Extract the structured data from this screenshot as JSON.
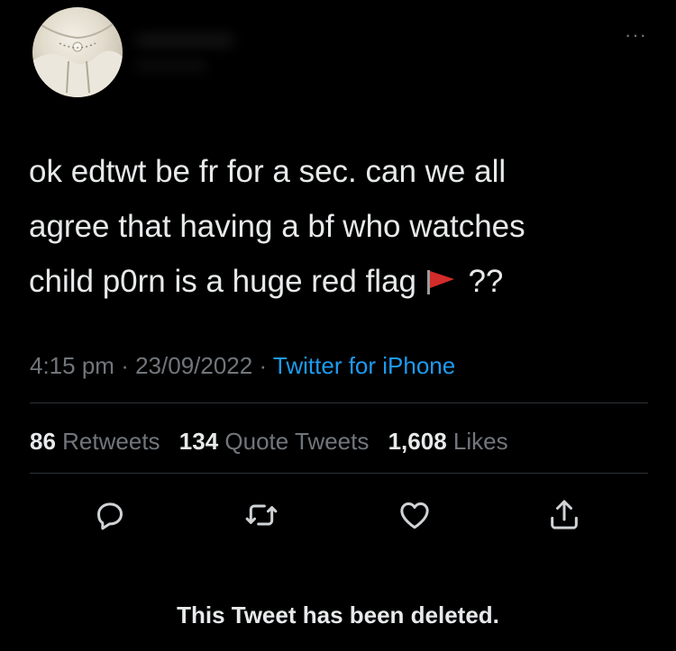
{
  "tweet": {
    "text_line1": "ok edtwt be fr for a sec. can we all",
    "text_line2": "agree that having a bf who watches",
    "text_line3_before_flag": "child p0rn is a huge red flag",
    "text_line3_after_flag": "??",
    "flag_emoji": "red-flag-icon"
  },
  "meta": {
    "time": "4:15 pm",
    "separator": "·",
    "date": "23/09/2022",
    "source": "Twitter for iPhone"
  },
  "stats": {
    "retweets_count": "86",
    "retweets_label": "Retweets",
    "quotes_count": "134",
    "quotes_label": "Quote Tweets",
    "likes_count": "1,608",
    "likes_label": "Likes"
  },
  "actions": {
    "reply_icon": "reply-icon",
    "retweet_icon": "retweet-icon",
    "like_icon": "heart-icon",
    "share_icon": "share-icon"
  },
  "more_icon": "more-icon",
  "footer": {
    "deleted_notice": "This Tweet has been deleted."
  },
  "colors": {
    "background": "#000000",
    "text": "#e7e9ea",
    "muted": "#71767b",
    "link": "#1d9bf0",
    "divider": "#2f3336",
    "flag": "#d42b2b"
  }
}
